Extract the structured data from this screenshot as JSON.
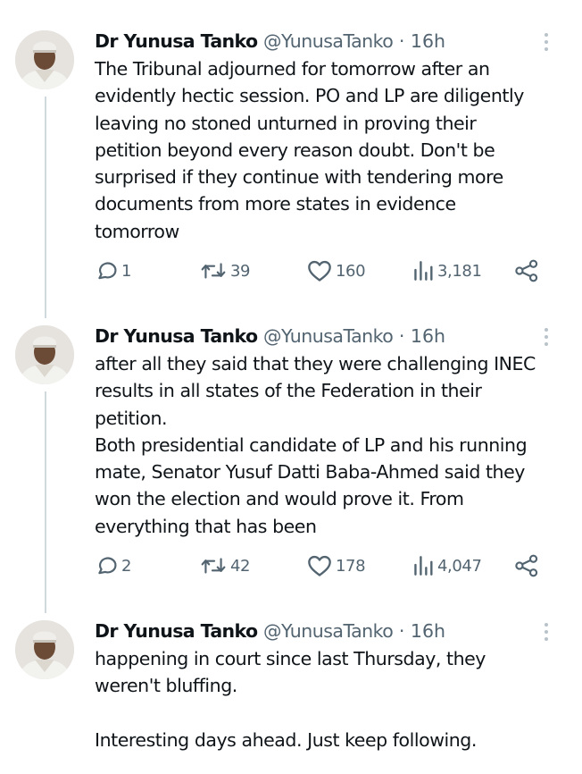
{
  "tweets": [
    {
      "name": "Dr Yunusa Tanko",
      "handle": "@YunusaTanko",
      "separator": "·",
      "time": "16h",
      "text": "The Tribunal adjourned for tomorrow after an\nevidently hectic session. PO and LP are diligently\nleaving no stoned unturned in proving their\npetition beyond every reason doubt. Don't be\nsurprised if they continue with tendering more\ndocuments from more states in evidence\ntomorrow",
      "replies": "1",
      "reposts": "39",
      "likes": "160",
      "views": "3,181"
    },
    {
      "name": "Dr Yunusa Tanko",
      "handle": "@YunusaTanko",
      "separator": "·",
      "time": "16h",
      "text": "after all they said that they were challenging INEC\nresults in all states of the Federation in their\npetition.\nBoth presidential candidate of LP and his running\nmate, Senator Yusuf Datti Baba-Ahmed said they\nwon the election and would prove it. From\neverything that has been",
      "replies": "2",
      "reposts": "42",
      "likes": "178",
      "views": "4,047"
    },
    {
      "name": "Dr Yunusa Tanko",
      "handle": "@YunusaTanko",
      "separator": "·",
      "time": "16h",
      "text": "happening in court since last Thursday, they\nweren't bluffing.\n\nInteresting days ahead. Just keep following."
    }
  ],
  "icons": {
    "reply": "reply-icon",
    "repost": "repost-icon",
    "like": "heart-icon",
    "views": "views-chart-icon",
    "share": "share-icon",
    "more": "more-vertical-icon"
  },
  "colors": {
    "text": "#0f1419",
    "muted": "#536471",
    "thread_line": "#cfd9de"
  }
}
